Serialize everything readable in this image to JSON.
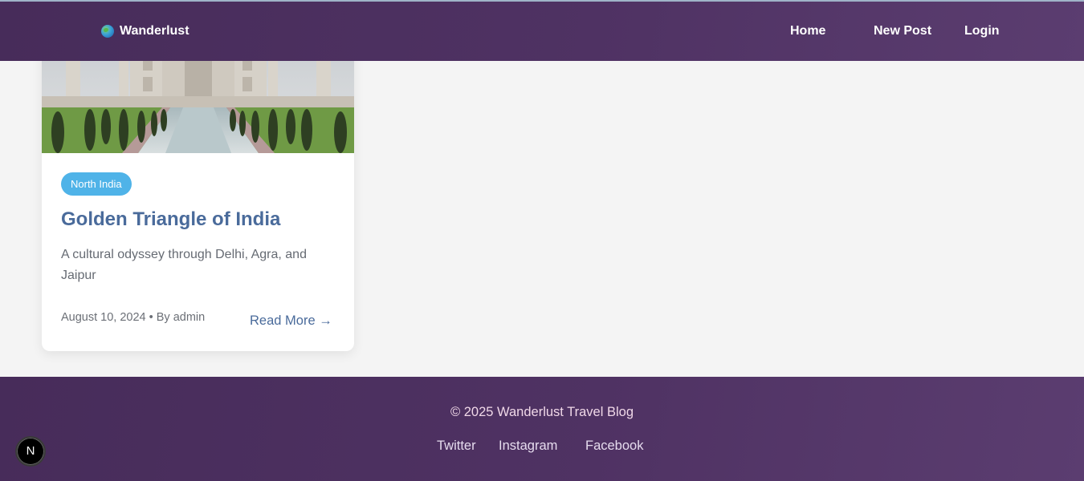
{
  "header": {
    "brand": "Wanderlust",
    "brand_icon": "globe-icon",
    "nav": {
      "home": "Home",
      "new_post": "New Post",
      "login": "Login"
    }
  },
  "card": {
    "image_alt": "Taj Mahal",
    "badge": "North India",
    "title": "Golden Triangle of India",
    "description": "A cultural odyssey through Delhi, Agra, and Jaipur",
    "meta": "August 10, 2024 • By admin",
    "read_more": "Read More →"
  },
  "footer": {
    "copyright": "© 2025 Wanderlust Travel Blog",
    "links": {
      "twitter": "Twitter",
      "instagram": "Instagram",
      "facebook": "Facebook"
    }
  },
  "dev_badge": {
    "label": "N"
  },
  "colors": {
    "header_bg": "#4f3263",
    "page_bg": "#f4f4f4",
    "accent_title": "#4a6b9b",
    "badge_bg": "#4fb3e8"
  }
}
